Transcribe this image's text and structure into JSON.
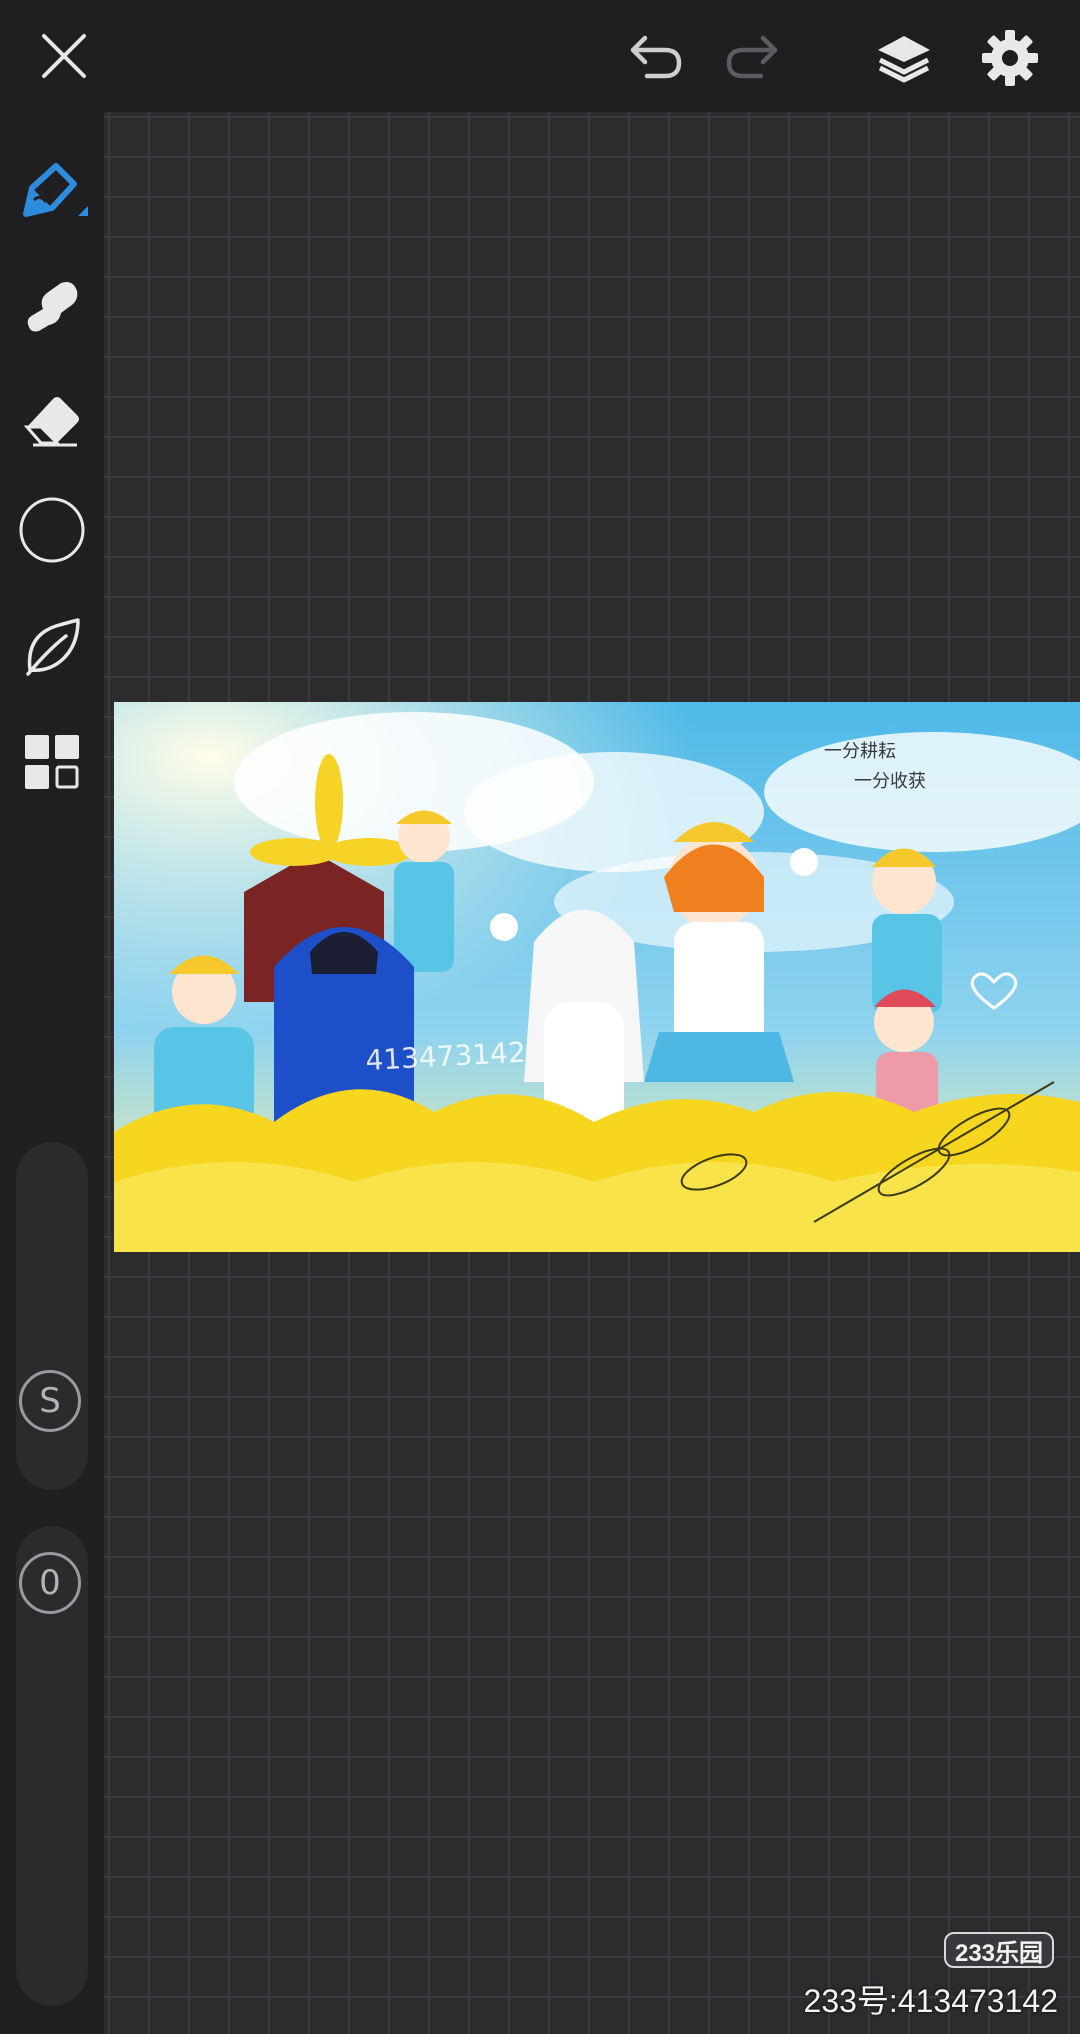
{
  "toolbar": {
    "close_icon": "close-icon",
    "undo_icon": "undo-icon",
    "redo_icon": "redo-icon",
    "layers_icon": "layers-icon",
    "settings_icon": "gear-icon"
  },
  "sidebar": {
    "tools": [
      {
        "name": "pen-tool",
        "icon": "pen-icon",
        "active": true
      },
      {
        "name": "smudge-tool",
        "icon": "finger-smudge-icon"
      },
      {
        "name": "eraser-tool",
        "icon": "eraser-icon"
      },
      {
        "name": "color-picker",
        "icon": "circle-icon"
      },
      {
        "name": "brush-library",
        "icon": "leaf-icon"
      },
      {
        "name": "more-tools",
        "icon": "grid-icon"
      }
    ],
    "size_slider": {
      "label": "S"
    },
    "opacity_slider": {
      "label": "0"
    }
  },
  "artwork": {
    "caption_line1": "一分耕耘",
    "caption_line2": "一分收获",
    "drawn_id": "413473142"
  },
  "watermark": {
    "badge": "233乐园",
    "id_text": "233号:413473142"
  },
  "colors": {
    "accent": "#2f8bdc",
    "bar": "#1f1e21",
    "canvas": "#2c2b2e",
    "grid": "#3b3a3e"
  }
}
